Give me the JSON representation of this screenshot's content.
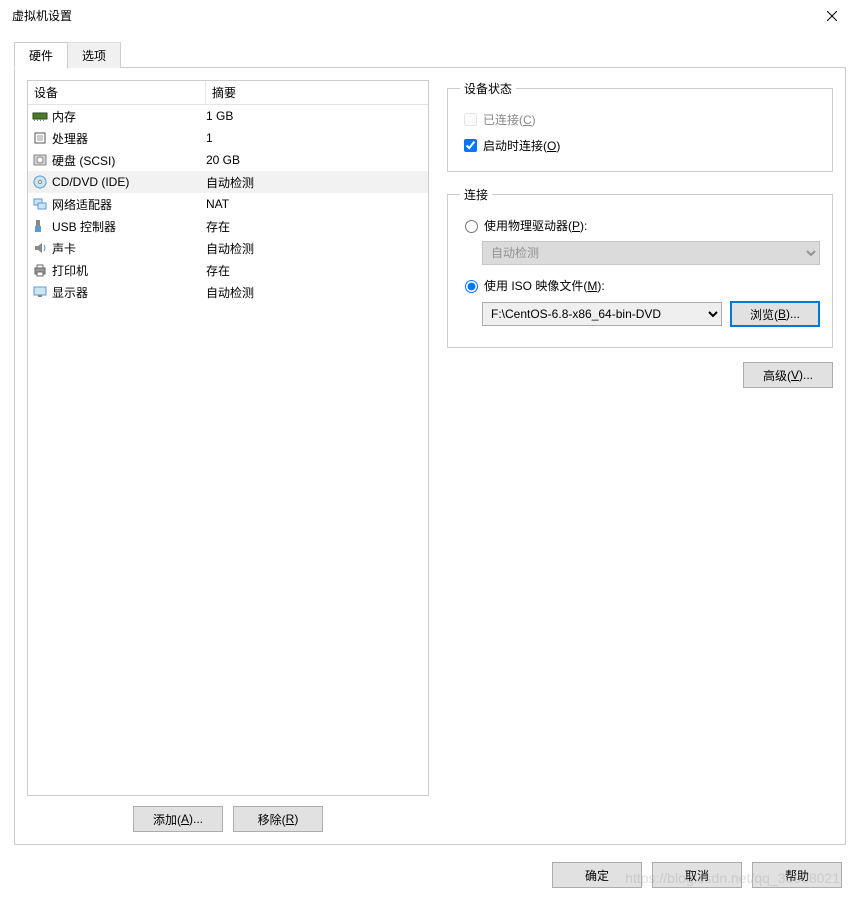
{
  "window": {
    "title": "虚拟机设置"
  },
  "tabs": {
    "hardware": "硬件",
    "options": "选项"
  },
  "devlist": {
    "header": {
      "device": "设备",
      "summary": "摘要"
    },
    "rows": [
      {
        "name": "内存",
        "summary": "1 GB"
      },
      {
        "name": "处理器",
        "summary": "1"
      },
      {
        "name": "硬盘 (SCSI)",
        "summary": "20 GB"
      },
      {
        "name": "CD/DVD (IDE)",
        "summary": "自动检测"
      },
      {
        "name": "网络适配器",
        "summary": "NAT"
      },
      {
        "name": "USB 控制器",
        "summary": "存在"
      },
      {
        "name": "声卡",
        "summary": "自动检测"
      },
      {
        "name": "打印机",
        "summary": "存在"
      },
      {
        "name": "显示器",
        "summary": "自动检测"
      }
    ]
  },
  "buttons": {
    "add": "添加(A)...",
    "remove": "移除(R)",
    "browse": "浏览(B)...",
    "advanced": "高级(V)...",
    "ok": "确定",
    "cancel": "取消",
    "help": "帮助"
  },
  "devstate": {
    "legend": "设备状态",
    "connected": "已连接(C)",
    "connect_on_power": "启动时连接(O)"
  },
  "connection": {
    "legend": "连接",
    "physical": "使用物理驱动器(P):",
    "physical_value": "自动检测",
    "iso": "使用 ISO 映像文件(M):",
    "iso_value": "F:\\CentOS-6.8-x86_64-bin-DVD"
  },
  "watermark": "https://blog.csdn.net/qq_36008021"
}
